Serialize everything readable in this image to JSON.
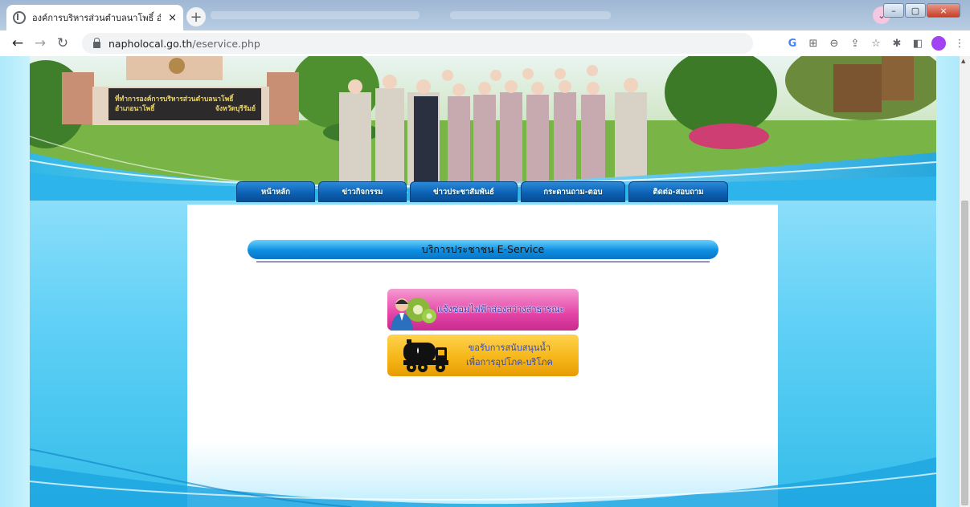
{
  "browser": {
    "tab_title": "องค์การบริหารส่วนตำบลนาโพธิ์ อำ...",
    "tab_close": "×",
    "new_tab": "+",
    "tab_search": "⌄",
    "window_buttons": {
      "minimize": "–",
      "maximize": "▢",
      "close": "×"
    },
    "back": "←",
    "forward": "→",
    "reload": "↻",
    "url_host": "napholocal.go.th",
    "url_path": "/eservice.php",
    "toolbar_icons": [
      "G",
      "⊞",
      "⊖",
      "⇪",
      "☆",
      "✱",
      "◧",
      "⋮"
    ]
  },
  "banner": {
    "sign_line1": "ที่ทำการองค์การบริหารส่วนตำบลนาโพธิ์",
    "sign_line2": "อำเภอนาโพธิ์",
    "sign_line3": "จังหวัดบุรีรัมย์"
  },
  "nav": {
    "items": [
      {
        "label": "หน้าหลัก"
      },
      {
        "label": "ข่าวกิจกรรม"
      },
      {
        "label": "ข่าวประชาสัมพันธ์"
      },
      {
        "label": "กระดานถาม-ตอบ"
      },
      {
        "label": "ติดต่อ-สอบถาม"
      }
    ]
  },
  "section": {
    "title": "บริการประชาชน E-Service"
  },
  "services": [
    {
      "label": "แจ้งซ่อมไฟฟ้าส่องสว่างสาธารณะ",
      "icon": "repair-technician-icon",
      "color": "#e544a7"
    },
    {
      "label_line1": "ขอรับการสนับสนุนน้ำ",
      "label_line2": "เพื่อการอุปโภค-บริโภค",
      "icon": "water-truck-icon",
      "color": "#f5b515"
    }
  ]
}
